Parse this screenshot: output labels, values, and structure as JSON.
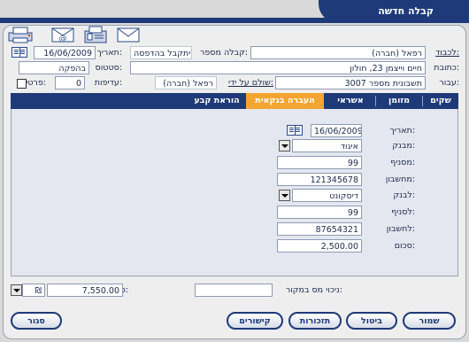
{
  "window": {
    "title": "קבלה חדשה"
  },
  "toolbar": {
    "icons": [
      "email-icon",
      "email-at-icon",
      "fax-icon",
      "printer-icon"
    ]
  },
  "header": {
    "to_label": "לכבוד:",
    "to_value": "רפאל (חברה)",
    "receipt_num_label": "קבלה מספר:",
    "receipt_num_value": "יתקבל בהדפסה",
    "date_label": "תאריך:",
    "date_value": "16/06/2009",
    "address_label": "כתובת:",
    "address_value": "חיים וייצמן 23, חולון",
    "status_label": "סטטוס:",
    "status_value": "בהפקה",
    "subject_label": "עבור:",
    "subject_value": "תשבונית מספר 3007",
    "paid_by_label": "שולם על ידי:",
    "paid_by_value": "רפאל (חברה)",
    "copies_label": "עדיפות:",
    "copies_value": "0",
    "private_label": "פרטי:"
  },
  "tabs": [
    {
      "label": "שקים"
    },
    {
      "label": "מזומן"
    },
    {
      "label": "אשראי"
    },
    {
      "label": "העברה בנקאית"
    },
    {
      "label": "הוראת קבע"
    }
  ],
  "transfer": {
    "date_label": "תאריך:",
    "date_value": "16/06/2009",
    "from_bank_label": "מבנק:",
    "from_bank_value": "איגוד",
    "from_branch_label": "מסניף:",
    "from_branch_value": "99",
    "from_account_label": "מחשבון:",
    "from_account_value": "121345678",
    "to_bank_label": "לבנק:",
    "to_bank_value": "דיסקונט",
    "to_branch_label": "לסניף:",
    "to_branch_value": "99",
    "to_account_label": "לחשבון:",
    "to_account_value": "87654321",
    "amount_label": "סכום:",
    "amount_value": "2,500.00"
  },
  "footer": {
    "withholding_label": "ניכוי מס במקור:",
    "withholding_value": "",
    "total_label": "סה\"כ:",
    "total_value": "7,550.00",
    "currency_value": "₪"
  },
  "buttons": {
    "save": "שמור",
    "cancel": "ביטול",
    "reminders": "תזכורות",
    "links": "קישורים",
    "close": "סגור"
  },
  "colors": {
    "accent": "#1e3a78",
    "active_tab": "#f4a430",
    "panel": "#eeeeee"
  }
}
